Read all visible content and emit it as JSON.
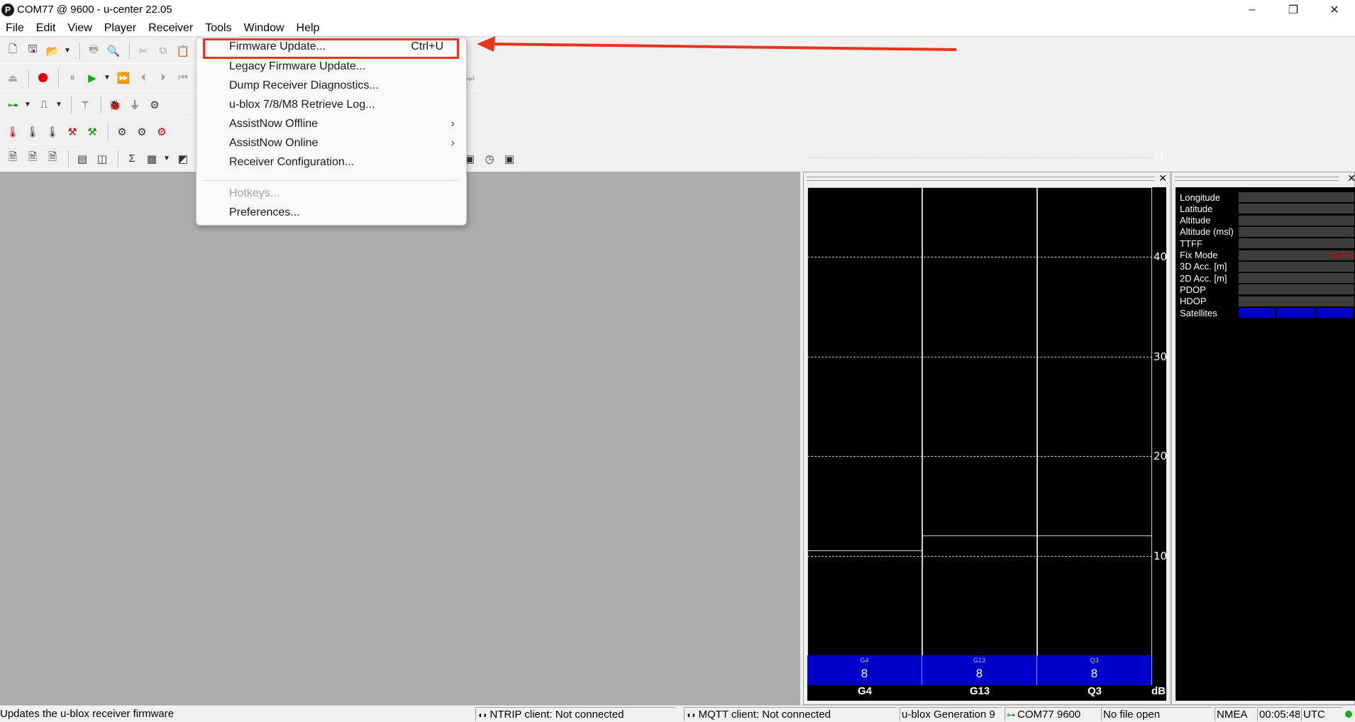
{
  "window": {
    "title": "COM77 @ 9600 - u-center 22.05",
    "logo_letter": "P",
    "controls": [
      "–",
      "❐",
      "✕"
    ]
  },
  "menubar": [
    "File",
    "Edit",
    "View",
    "Player",
    "Receiver",
    "Tools",
    "Window",
    "Help"
  ],
  "tools_menu": {
    "items": [
      {
        "label": "Firmware Update...",
        "shortcut": "Ctrl+U",
        "enabled": true,
        "submenu": false
      },
      {
        "label": "Legacy Firmware Update...",
        "enabled": true,
        "submenu": false
      },
      {
        "label": "Dump Receiver Diagnostics...",
        "enabled": true,
        "submenu": false
      },
      {
        "label": "u-blox 7/8/M8 Retrieve Log...",
        "enabled": true,
        "submenu": false
      },
      {
        "label": "AssistNow Offline",
        "enabled": true,
        "submenu": true
      },
      {
        "label": "AssistNow Online",
        "enabled": true,
        "submenu": true
      },
      {
        "label": "Receiver Configuration...",
        "enabled": true,
        "submenu": false
      },
      {
        "label": "Hotkeys...",
        "enabled": false,
        "submenu": false
      },
      {
        "label": "Preferences...",
        "enabled": true,
        "submenu": false
      }
    ]
  },
  "annotation": {
    "box_color": "#e8341c",
    "arrow_color": "#e8341c"
  },
  "signal_panel": {
    "y_ticks": [
      "50",
      "40",
      "30",
      "20",
      "10"
    ],
    "unit": "dB",
    "satellites": [
      {
        "id": "G4",
        "small_label": "G4",
        "count": "8",
        "level": 10.5
      },
      {
        "id": "G13",
        "small_label": "G13",
        "count": "8",
        "level": 12.0
      },
      {
        "id": "Q3",
        "small_label": "Q3",
        "count": "8",
        "level": 12.0
      }
    ]
  },
  "data_panel": {
    "rows": [
      {
        "label": "Longitude",
        "value": ""
      },
      {
        "label": "Latitude",
        "value": ""
      },
      {
        "label": "Altitude",
        "value": ""
      },
      {
        "label": "Altitude (msl)",
        "value": ""
      },
      {
        "label": "TTFF",
        "value": ""
      },
      {
        "label": "Fix Mode",
        "value": "No Fix"
      },
      {
        "label": "3D Acc. [m]",
        "value": ""
      },
      {
        "label": "2D Acc. [m]",
        "value": ""
      },
      {
        "label": "PDOP",
        "value": ""
      },
      {
        "label": "HDOP",
        "value": ""
      },
      {
        "label": "Satellites",
        "value": ""
      }
    ]
  },
  "statusbar": {
    "hint": "Updates the u-blox receiver firmware",
    "ntrip": "NTRIP client: Not connected",
    "mqtt": "MQTT client: Not connected",
    "generation": "u-blox Generation 9",
    "port": "COM77 9600",
    "file": "No file open",
    "protocol": "NMEA",
    "time": "00:05:48",
    "tz": "UTC"
  },
  "colors": {
    "satellite_bar": "#0000c8",
    "fix_mode_text": "#e00000",
    "record": "#e00000",
    "play": "#00b000"
  }
}
